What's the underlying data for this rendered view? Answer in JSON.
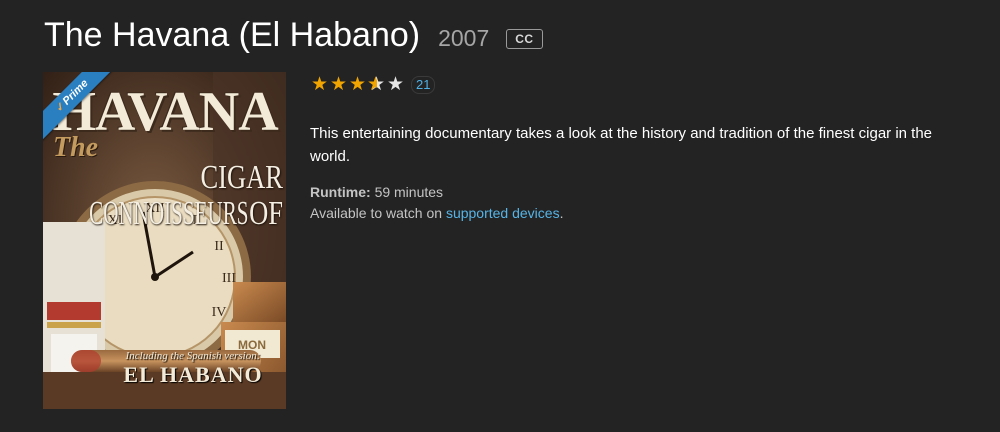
{
  "title": "The Havana (El Habano)",
  "year": "2007",
  "cc_badge": "CC",
  "poster": {
    "prime_badge": "Prime",
    "headline": "HAVANA",
    "the": "The",
    "line2": "CIGAR OF",
    "line3": "CONNOISSEURS",
    "including": "Including the Spanish version:",
    "spanish_title": "EL HABANO",
    "box_brand": "MON"
  },
  "rating": {
    "stars": 3.5,
    "max": 5,
    "count": "21"
  },
  "description": "This entertaining documentary takes a look at the history and tradition of the finest cigar in the world.",
  "runtime": {
    "label": "Runtime:",
    "value": "59 minutes"
  },
  "availability": {
    "prefix": "Available to watch on ",
    "link_text": "supported devices",
    "suffix": "."
  },
  "colors": {
    "background": "#232323",
    "star": "#f0a500",
    "link": "#56b4e6",
    "prime": "#2a7fc1"
  }
}
